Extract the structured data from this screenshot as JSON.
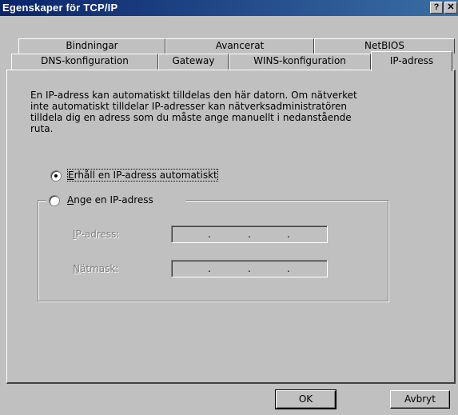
{
  "window": {
    "title": "Egenskaper för TCP/IP",
    "help_label": "?",
    "close_label": "✕"
  },
  "tabs_back": [
    {
      "label": "Bindningar"
    },
    {
      "label": "Avancerat"
    },
    {
      "label": "NetBIOS"
    }
  ],
  "tabs_front": [
    {
      "label": "DNS-konfiguration"
    },
    {
      "label": "Gateway"
    },
    {
      "label": "WINS-konfiguration"
    },
    {
      "label": "IP-adress"
    }
  ],
  "description": "En IP-adress kan automatiskt tilldelas den här datorn. Om nätverket inte automatiskt tilldelar IP-adresser kan nätverksadministratören tilldela dig en adress som du måste ange manuellt i nedanstående ruta.",
  "options": {
    "auto_first": "E",
    "auto_rest": "rhåll en IP-adress automatiskt",
    "manual_first": "A",
    "manual_rest": "nge en IP-adress",
    "selected": "auto"
  },
  "fields": {
    "ip_first": "I",
    "ip_rest": "P-adress:",
    "mask_first": "N",
    "mask_rest": "ätmask:",
    "dot": "."
  },
  "buttons": {
    "ok": "OK",
    "cancel": "Avbryt"
  }
}
